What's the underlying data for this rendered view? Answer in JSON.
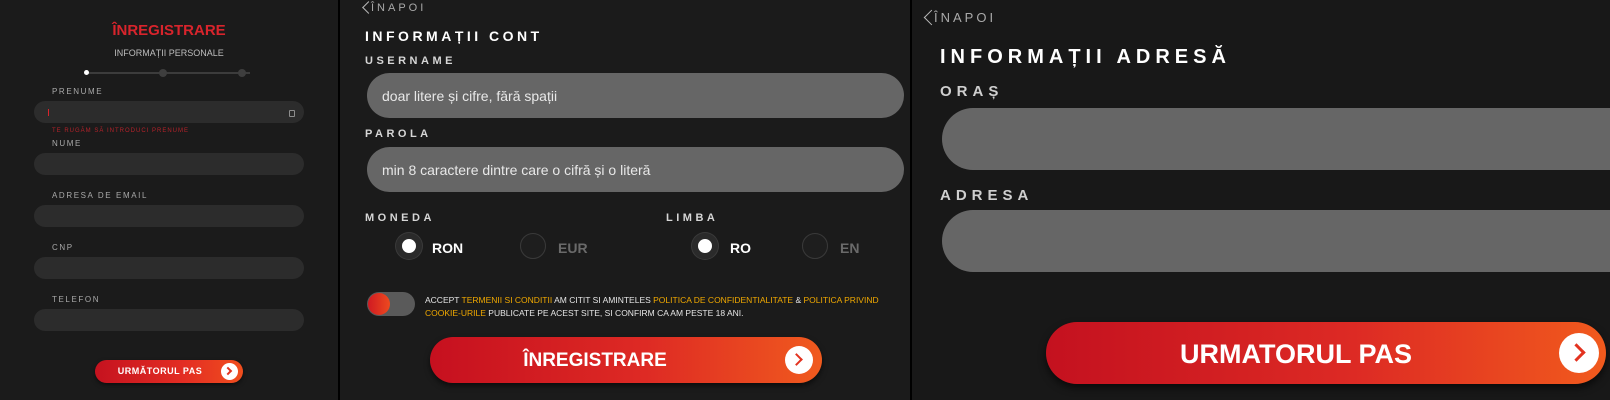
{
  "panel1": {
    "title": "ÎNREGISTRARE",
    "subtitle": "INFORMAȚII PERSONALE",
    "steps_total": 3,
    "step_current": 1,
    "fields": [
      {
        "label": "PRENUME",
        "value": ""
      },
      {
        "label": "NUME",
        "value": ""
      },
      {
        "label": "ADRESA DE EMAIL",
        "value": ""
      },
      {
        "label": "CNP",
        "value": ""
      },
      {
        "label": "TELEFON",
        "value": ""
      }
    ],
    "error_text": "TE RUGĂM SĂ INTRODUCI PRENUME",
    "next_button": "URMĂTORUL PAS"
  },
  "panel2": {
    "back_label": "ÎNAPOI",
    "heading": "INFORMAȚII CONT",
    "username": {
      "label": "USERNAME",
      "placeholder": "doar litere și cifre, fără spații"
    },
    "password": {
      "label": "PAROLA",
      "placeholder": "min 8 caractere dintre care o cifră și o literă"
    },
    "currency": {
      "label": "MONEDA",
      "options": [
        "RON",
        "EUR"
      ],
      "selected": "RON"
    },
    "language": {
      "label": "LIMBA",
      "options": [
        "RO",
        "EN"
      ],
      "selected": "RO"
    },
    "terms": {
      "t1": "ACCEPT ",
      "link1": "TERMENII SI CONDITII",
      "t2": " AM CITIT SI AMINTELES ",
      "link2": "POLITICA DE CONFIDENTIALITATE",
      "t3": " & ",
      "link3": "POLITICA PRIVIND COOKIE-URILE",
      "t4": " PUBLICATE PE ACEST SITE, SI CONFIRM CA AM PESTE 18 ANI."
    },
    "submit_button": "ÎNREGISTRARE"
  },
  "panel3": {
    "back_label": "ÎNAPOI",
    "heading": "INFORMAȚII ADRESĂ",
    "city": {
      "label": "ORAȘ",
      "value": ""
    },
    "address": {
      "label": "ADRESA",
      "value": ""
    },
    "next_button": "URMATORUL PAS"
  },
  "colors": {
    "accent_red": "#d8242c",
    "button_gradient_start": "#c6101f",
    "button_gradient_end": "#f05a1e",
    "link_yellow": "#f0a800",
    "field_dark": "#2c2c2c",
    "field_grey": "#666666"
  }
}
